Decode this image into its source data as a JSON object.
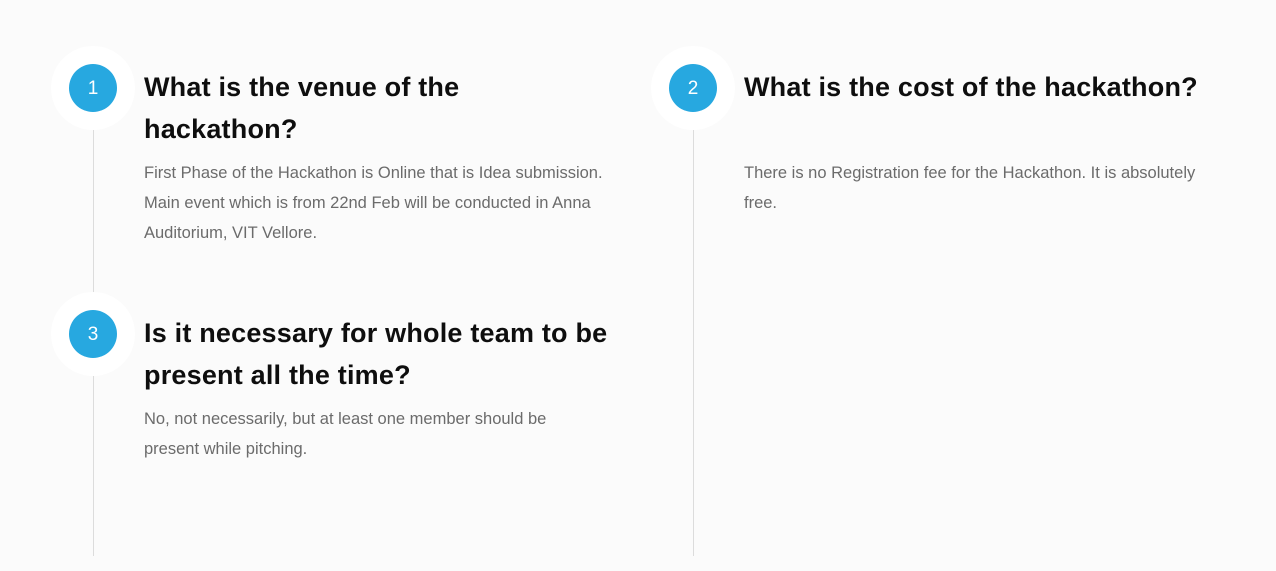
{
  "faq": [
    {
      "number": "1",
      "question": "What is the venue of the hackathon?",
      "answer": "First Phase of the Hackathon is Online that is Idea submission. Main event which is from 22nd Feb will be conducted in Anna Auditorium, VIT Vellore."
    },
    {
      "number": "2",
      "question": "What is the cost of the hackathon?",
      "answer": "There is no Registration fee for the Hackathon. It is absolutely free."
    },
    {
      "number": "3",
      "question": "Is it necessary for whole team to be present all the time?",
      "answer": "No, not necessarily, but at least one member should be present while pitching."
    }
  ],
  "colors": {
    "badge": "#27a8e0",
    "question": "#0e0e0e",
    "answer": "#6b6b6b",
    "line": "#dcdcdc",
    "background": "#fbfbfb"
  }
}
